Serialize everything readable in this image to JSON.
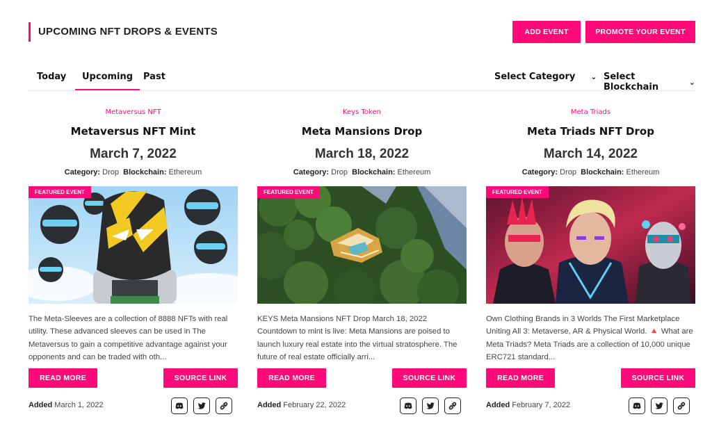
{
  "header": {
    "title": "UPCOMING NFT DROPS & EVENTS",
    "add_event_label": "ADD EVENT",
    "promote_label": "PROMOTE YOUR EVENT"
  },
  "tabs": [
    {
      "label": "Today",
      "active": false
    },
    {
      "label": "Upcoming",
      "active": true
    },
    {
      "label": "Past",
      "active": false
    }
  ],
  "filters": {
    "category_label": "Select Category",
    "blockchain_label": "Select Blockchain",
    "chevron": "⌄"
  },
  "labels": {
    "category": "Category:",
    "blockchain": "Blockchain:",
    "added": "Added",
    "featured": "FEATURED EVENT",
    "read_more": "READ MORE",
    "source_link": "SOURCE LINK"
  },
  "cards": [
    {
      "project": "Metaversus NFT",
      "name": "Metaversus NFT Mint",
      "date": "March 7, 2022",
      "category": "Drop",
      "blockchain": "Ethereum",
      "description": "The Meta-Sleeves are a collection of 8888 NFTs with real utility. These advanced sleeves can be used in The Metaversus to gain a competitive advantage against your opponents and can be traded with oth...",
      "added": "March 1, 2022"
    },
    {
      "project": "Keys Token",
      "name": "Meta Mansions Drop",
      "date": "March 18, 2022",
      "category": "Drop",
      "blockchain": "Ethereum",
      "description": "KEYS Meta Mansions NFT Drop March 18, 2022 Countdown to mint is live: Meta Mansions are poised to launch luxury real estate into the virtual stratosphere. The future of real estate officially arri...",
      "added": "February 22, 2022"
    },
    {
      "project": "Meta Triads",
      "name": "Meta Triads NFT Drop",
      "date": "March 14, 2022",
      "category": "Drop",
      "blockchain": "Ethereum",
      "description": "Own Clothing Brands in 3 Worlds The First Marketplace Uniting All 3: Metaverse, AR & Physical World. 🔺 What are Meta Triads? Meta Triads are a collection of 10,000 unique ERC721 standard...",
      "added": "February 7, 2022"
    }
  ],
  "social_icons": [
    "discord-icon",
    "twitter-icon",
    "link-icon"
  ],
  "colors": {
    "accent": "#ff0a78",
    "text": "#222222"
  }
}
